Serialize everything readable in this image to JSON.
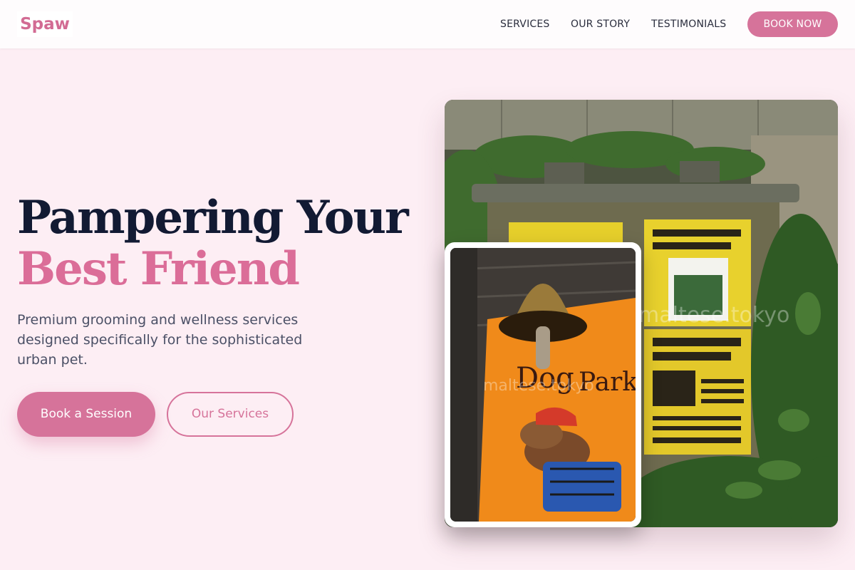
{
  "brand": {
    "logo": "Spaw",
    "accent": "#d6739a",
    "heading_dark": "#121a33",
    "heading_pink": "#db6d98",
    "background": "#fdeef4"
  },
  "nav": {
    "links": [
      "SERVICES",
      "OUR STORY",
      "TESTIMONIALS"
    ],
    "cta": "BOOK NOW"
  },
  "hero": {
    "headline_line1": "Pampering Your",
    "headline_line2": "Best Friend",
    "subtitle": "Premium grooming and wellness services designed specifically for the sophisticated urban pet.",
    "primary_button": "Book a Session",
    "secondary_button": "Our Services"
  },
  "images": {
    "main": {
      "alt": "Weathered utility box covered in yellow posters surrounded by greenery",
      "watermark": "maltese.tokyo"
    },
    "inset": {
      "alt": "Brass bell hanging above an orange dog park sign with a cartoon dachshund",
      "watermark": "maltese.tokyo"
    }
  }
}
